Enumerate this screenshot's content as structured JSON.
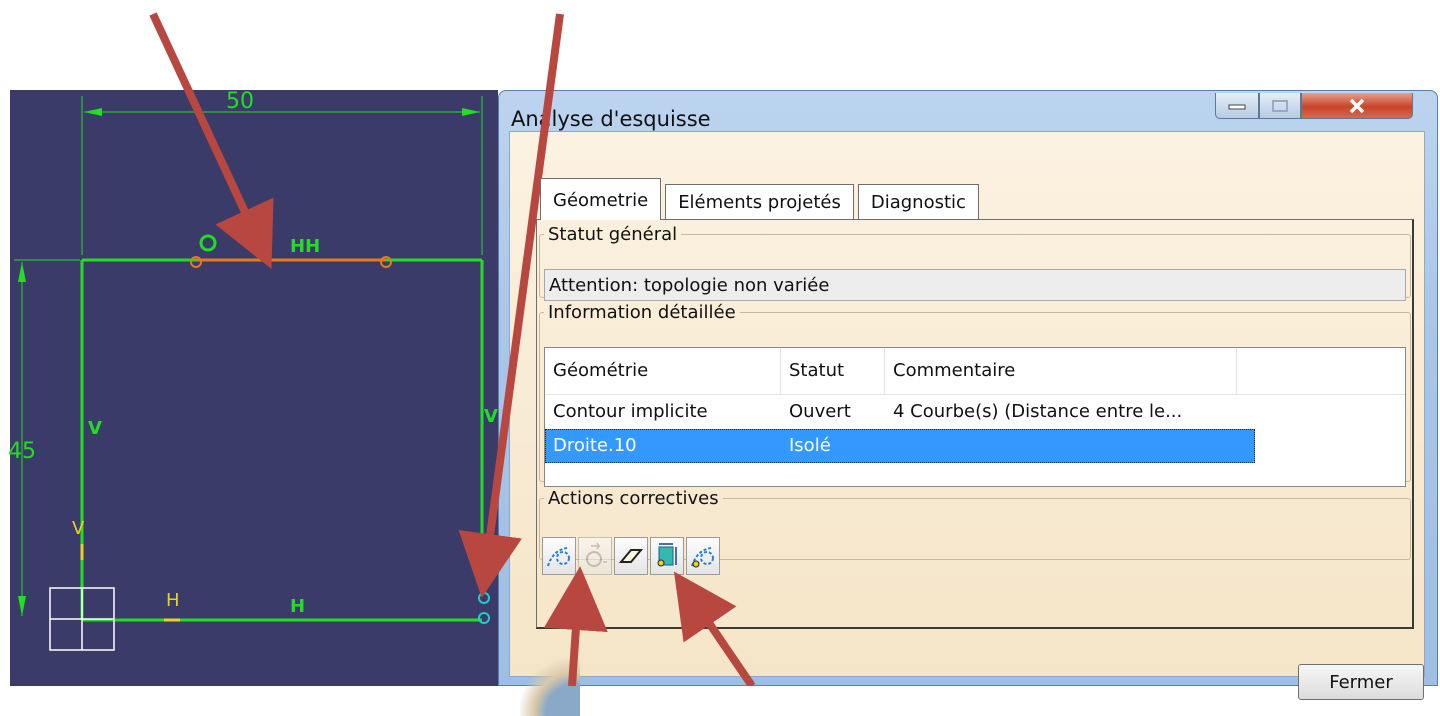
{
  "sketch": {
    "dimension_horizontal": "50",
    "dimension_vertical": "45",
    "constraint_v": "V",
    "constraint_h": "H",
    "constraint_hh": "HH",
    "constraint_v_yellow": "V",
    "constraint_h_yellow": "H",
    "colors": {
      "background": "#3b3b6a",
      "geometry": "#22dd22",
      "highlight": "#e07b20",
      "construction_point": "#22cccc",
      "anchor": "#e8d21e"
    }
  },
  "dialog": {
    "title": "Analyse d'esquisse",
    "tabs": [
      {
        "label": "Géometrie",
        "active": true
      },
      {
        "label": "Eléments projetés",
        "active": false
      },
      {
        "label": "Diagnostic",
        "active": false
      }
    ],
    "general_status": {
      "legend": "Statut général",
      "value": "Attention: topologie non variée"
    },
    "detail": {
      "legend": "Information détaillée",
      "columns": [
        "Géométrie",
        "Statut",
        "Commentaire",
        ""
      ],
      "rows": [
        {
          "geometry": "Contour implicite",
          "status": "Ouvert",
          "comment": "4 Courbe(s) (Distance entre le..."
        },
        {
          "geometry": "Droite.10",
          "status": "Isolé",
          "comment": "",
          "selected": true
        }
      ]
    },
    "actions": {
      "legend": "Actions correctives",
      "tools": [
        {
          "icon": "select-points-icon",
          "enabled": true
        },
        {
          "icon": "rotate-point-icon",
          "enabled": false
        },
        {
          "icon": "eraser-icon",
          "enabled": true
        },
        {
          "icon": "dimension-constraint-icon",
          "enabled": true
        },
        {
          "icon": "construction-points-icon",
          "enabled": true
        }
      ]
    },
    "close_label": "Fermer"
  },
  "annotation_color": "#b8473f"
}
